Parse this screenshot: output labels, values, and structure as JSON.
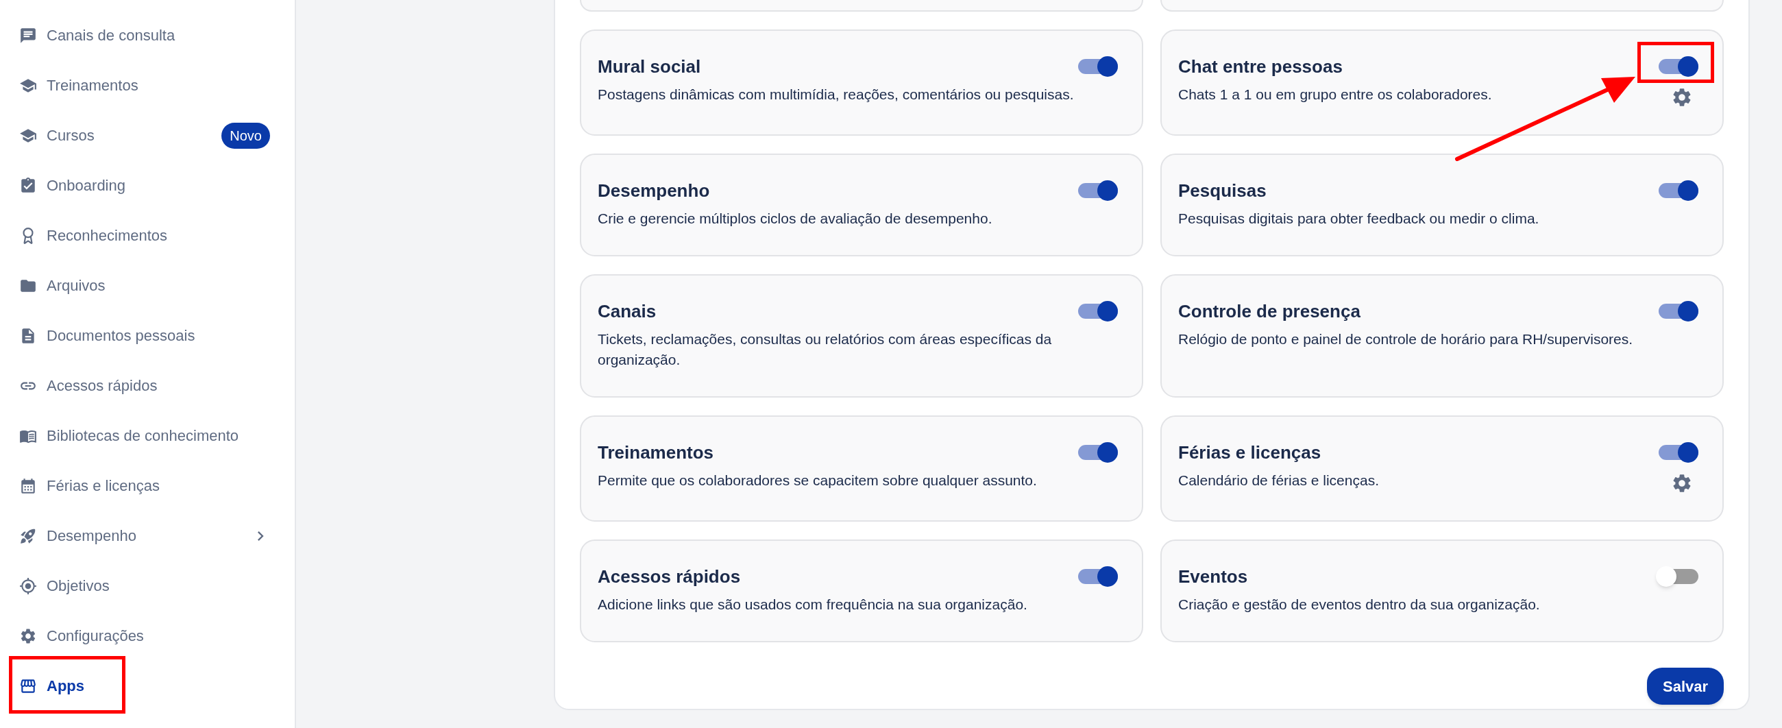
{
  "sidebar": {
    "items": [
      {
        "label": "Canais de consulta",
        "selected": false,
        "expandable": false
      },
      {
        "label": "Treinamentos",
        "selected": false,
        "expandable": false
      },
      {
        "label": "Cursos",
        "selected": false,
        "expandable": false,
        "badge": "Novo"
      },
      {
        "label": "Onboarding",
        "selected": false,
        "expandable": false
      },
      {
        "label": "Reconhecimentos",
        "selected": false,
        "expandable": false
      },
      {
        "label": "Arquivos",
        "selected": false,
        "expandable": false
      },
      {
        "label": "Documentos pessoais",
        "selected": false,
        "expandable": false
      },
      {
        "label": "Acessos rápidos",
        "selected": false,
        "expandable": false
      },
      {
        "label": "Bibliotecas de conhecimento",
        "selected": false,
        "expandable": false
      },
      {
        "label": "Férias e licenças",
        "selected": false,
        "expandable": false
      },
      {
        "label": "Desempenho",
        "selected": false,
        "expandable": true
      },
      {
        "label": "Objetivos",
        "selected": false,
        "expandable": false
      },
      {
        "label": "Configurações",
        "selected": false,
        "expandable": false
      },
      {
        "label": "Apps",
        "selected": true,
        "expandable": false
      }
    ]
  },
  "apps": [
    {
      "title": "Mural social",
      "description": "Postagens dinâmicas com multimídia, reações, comentários ou pesquisas.",
      "on": true,
      "settings": false
    },
    {
      "title": "Chat entre pessoas",
      "description": "Chats 1 a 1 ou em grupo entre os colaboradores.",
      "on": true,
      "settings": true
    },
    {
      "title": "Desempenho",
      "description": "Crie e gerencie múltiplos ciclos de avaliação de desempenho.",
      "on": true,
      "settings": false
    },
    {
      "title": "Pesquisas",
      "description": "Pesquisas digitais para obter feedback ou medir o clima.",
      "on": true,
      "settings": false
    },
    {
      "title": "Canais",
      "description": "Tickets, reclamações, consultas ou relatórios com áreas específicas da organização.",
      "on": true,
      "settings": false
    },
    {
      "title": "Controle de presença",
      "description": "Relógio de ponto e painel de controle de horário para RH/supervisores.",
      "on": true,
      "settings": false
    },
    {
      "title": "Treinamentos",
      "description": "Permite que os colaboradores se capacitem sobre qualquer assunto.",
      "on": true,
      "settings": false
    },
    {
      "title": "Férias e licenças",
      "description": "Calendário de férias e licenças.",
      "on": true,
      "settings": true
    },
    {
      "title": "Acessos rápidos",
      "description": "Adicione links que são usados com frequência na sua organização.",
      "on": true,
      "settings": false
    },
    {
      "title": "Eventos",
      "description": "Criação e gestão de eventos dentro da sua organização.",
      "on": false,
      "settings": false
    }
  ],
  "save_button": "Salvar"
}
